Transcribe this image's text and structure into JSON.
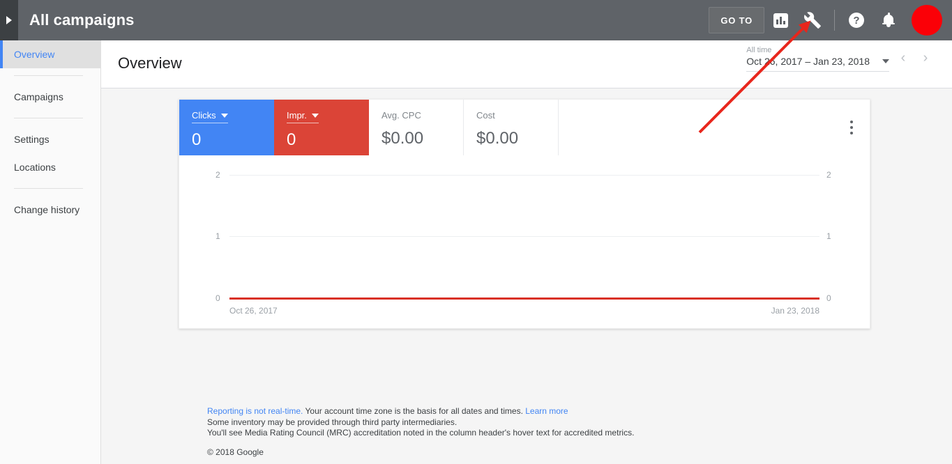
{
  "appbar": {
    "nav_toggle_icon": "expand-triangle-icon",
    "title": "All campaigns",
    "goto_label": "GO TO",
    "reports_icon": "reports-bar-chart-icon",
    "tools_icon": "wrench-tools-icon",
    "help_icon": "help-question-icon",
    "notifications_icon": "notification-bell-icon",
    "avatar_icon": "user-avatar",
    "avatar_color": "#fb0007"
  },
  "sidebar": {
    "items": [
      {
        "label": "Overview",
        "selected": true
      },
      {
        "label": "Campaigns",
        "selected": false
      },
      {
        "label": "Settings",
        "selected": false
      },
      {
        "label": "Locations",
        "selected": false
      },
      {
        "label": "Change history",
        "selected": false
      }
    ],
    "selected_color": "#4285f4"
  },
  "page": {
    "title": "Overview"
  },
  "daterange": {
    "preset_label": "All time",
    "value": "Oct 26, 2017 – Jan 23, 2018",
    "dropdown_icon": "chevron-down-icon",
    "prev_icon": "chevron-left-icon",
    "prev_glyph": "‹",
    "next_icon": "chevron-right-icon",
    "next_glyph": "›"
  },
  "metrics": [
    {
      "label": "Clicks",
      "value": "0",
      "style": "blue",
      "has_dropdown": true
    },
    {
      "label": "Impr.",
      "value": "0",
      "style": "red",
      "has_dropdown": true
    },
    {
      "label": "Avg. CPC",
      "value": "$0.00",
      "style": "plain",
      "has_dropdown": false
    },
    {
      "label": "Cost",
      "value": "$0.00",
      "style": "plain",
      "has_dropdown": false
    }
  ],
  "card": {
    "overflow_icon": "more-vertical-icon"
  },
  "chart_data": {
    "type": "line",
    "title": "",
    "xlabel": "",
    "ylabel": "",
    "x": [
      "Oct 26, 2017",
      "Jan 23, 2018"
    ],
    "x_tick_labels": [
      "Oct 26, 2017",
      "Jan 23, 2018"
    ],
    "y_tick_labels_left": [
      "2",
      "1",
      "0"
    ],
    "y_tick_labels_right": [
      "2",
      "1",
      "0"
    ],
    "ylim": [
      0,
      2
    ],
    "yticks": [
      0,
      1,
      2
    ],
    "grid": true,
    "legend": "none",
    "series": [
      {
        "name": "Impr.",
        "color": "#db4437",
        "values": [
          0,
          0
        ]
      },
      {
        "name": "Clicks",
        "color": "#4285f4",
        "values": [
          0,
          0
        ]
      }
    ]
  },
  "footer": {
    "line1_link": "Reporting is not real-time.",
    "line1_text": " Your account time zone is the basis for all dates and times. ",
    "line1_link2": "Learn more",
    "line2": "Some inventory may be provided through third party intermediaries.",
    "line3": "You'll see Media Rating Council (MRC) accreditation noted in the column header's hover text for accredited metrics.",
    "copyright": "© 2018 Google"
  },
  "annotation": {
    "arrow_icon": "red-arrow-annotation",
    "color": "#e8261c",
    "points_to": "wrench-tools-icon"
  }
}
